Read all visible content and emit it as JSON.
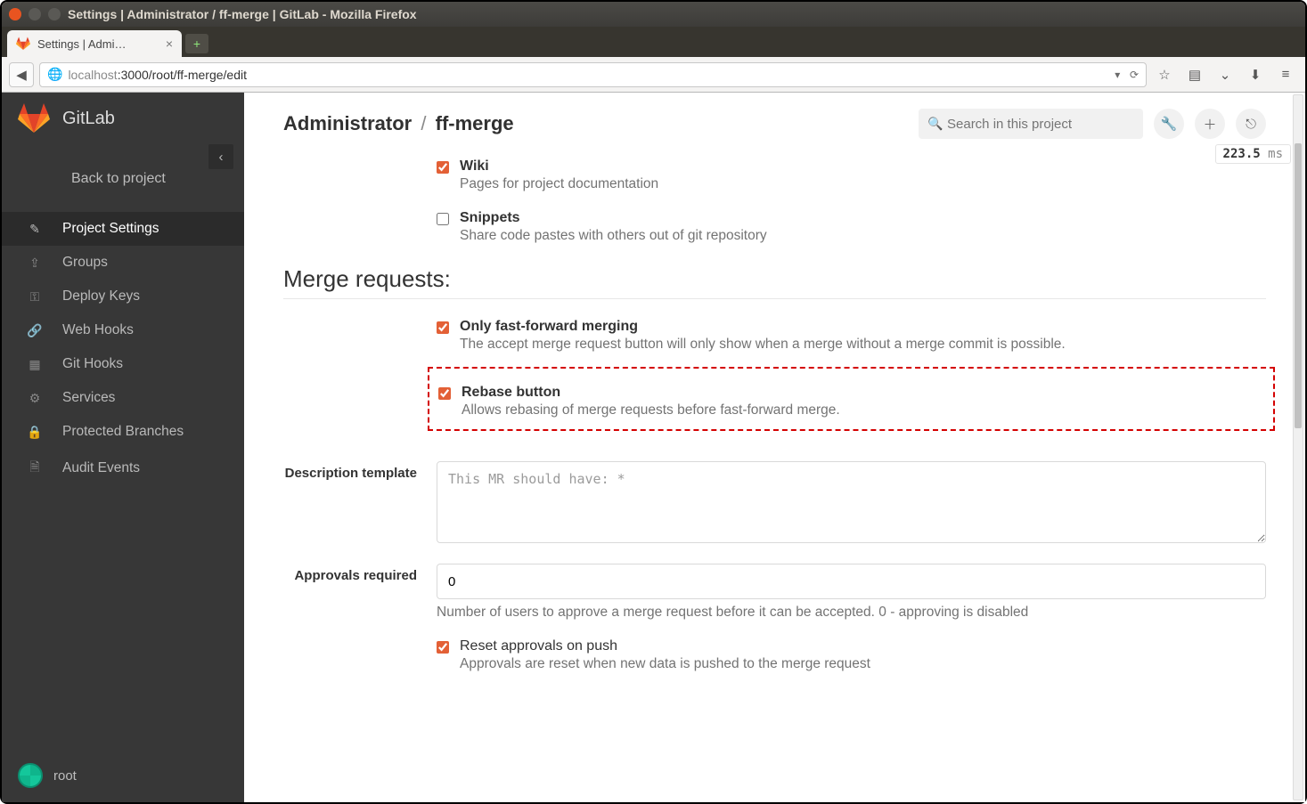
{
  "window": {
    "title": "Settings | Administrator / ff-merge | GitLab - Mozilla Firefox"
  },
  "browser": {
    "tab_title": "Settings | Admi…",
    "url_host": "localhost",
    "url_port_path": ":3000/root/ff-merge/edit",
    "new_tab_glyph": "+"
  },
  "sidebar": {
    "brand": "GitLab",
    "back": "Back to project",
    "items": [
      {
        "label": "Project Settings"
      },
      {
        "label": "Groups"
      },
      {
        "label": "Deploy Keys"
      },
      {
        "label": "Web Hooks"
      },
      {
        "label": "Git Hooks"
      },
      {
        "label": "Services"
      },
      {
        "label": "Protected Branches"
      },
      {
        "label": "Audit Events"
      }
    ],
    "user": "root"
  },
  "header": {
    "breadcrumb_owner": "Administrator",
    "breadcrumb_sep": "/",
    "breadcrumb_project": "ff-merge",
    "search_placeholder": "Search in this project",
    "timing_value": "223.5",
    "timing_unit": "ms"
  },
  "features": {
    "wiki": {
      "label": "Wiki",
      "help": "Pages for project documentation",
      "checked": true
    },
    "snippets": {
      "label": "Snippets",
      "help": "Share code pastes with others out of git repository",
      "checked": false
    }
  },
  "merge_section": {
    "title": "Merge requests:",
    "ff_only": {
      "label": "Only fast-forward merging",
      "help": "The accept merge request button will only show when a merge without a merge commit is possible.",
      "checked": true
    },
    "rebase": {
      "label": "Rebase button",
      "help": "Allows rebasing of merge requests before fast-forward merge.",
      "checked": true
    },
    "desc_label": "Description template",
    "desc_placeholder": "This MR should have: *",
    "approvals_label": "Approvals required",
    "approvals_value": "0",
    "approvals_help": "Number of users to approve a merge request before it can be accepted. 0 - approving is disabled",
    "reset": {
      "label": "Reset approvals on push",
      "help": "Approvals are reset when new data is pushed to the merge request",
      "checked": true
    }
  }
}
